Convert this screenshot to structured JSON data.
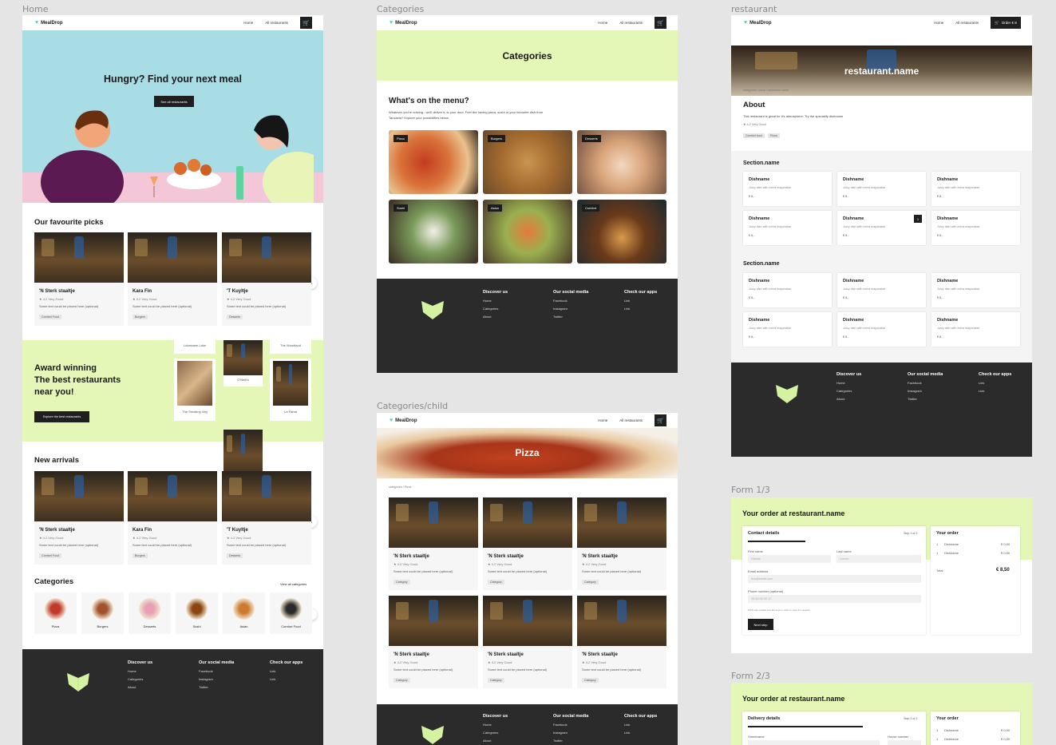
{
  "frames": {
    "home": "Home",
    "categories": "Categories",
    "restaurant": "restaurant",
    "categories_child": "Categories/child",
    "form1": "Form 1/3",
    "form2": "Form 2/3"
  },
  "nav": {
    "brand": "MealDrop",
    "home": "Home",
    "all": "All restaurants",
    "order": "Order € 8"
  },
  "home": {
    "hero_title": "Hungry? Find your next meal",
    "hero_button": "See all restaurants",
    "picks_title": "Our favourite picks",
    "picks": [
      {
        "name": "'N Sterk staaltje",
        "rating": "4.2 Very Good",
        "desc": "Some text could be placed here (optional)",
        "tag": "Comfort Food"
      },
      {
        "name": "Kara Fin",
        "rating": "4.2 Very Good",
        "desc": "Some text could be placed here (optional)",
        "tag": "Burgers"
      },
      {
        "name": "'T Kuyltje",
        "rating": "4.2 Very Good",
        "desc": "Some text could be placed here (optional)",
        "tag": "Desserts"
      }
    ],
    "award_title_1": "Award winning",
    "award_title_2": "The best restaurants near you!",
    "award_button": "Explore the best restaurants",
    "award_names": [
      "Lukewarm Lake",
      "The Woodland",
      "O'Neill's",
      "The Smoking Veg",
      "La Fama"
    ],
    "arrivals_title": "New arrivals",
    "arrivals": [
      {
        "name": "'N Sterk staaltje",
        "rating": "4.2 Very Good",
        "desc": "Some text could be placed here (optional)",
        "tag": "Comfort Food"
      },
      {
        "name": "Kara Fin",
        "rating": "4.2 Very Good",
        "desc": "Some text could be placed here (optional)",
        "tag": "Burgers"
      },
      {
        "name": "'T Kuyltje",
        "rating": "4.2 Very Good",
        "desc": "Some text could be placed here (optional)",
        "tag": "Desserts"
      }
    ],
    "categories_title": "Categories",
    "view_all": "View all categories",
    "cats": [
      "Pizza",
      "Burgers",
      "Desserts",
      "Sushi",
      "Asian",
      "Comfort Food"
    ]
  },
  "footer": {
    "col1": {
      "title": "Discover us",
      "links": [
        "Home",
        "Categories",
        "About"
      ]
    },
    "col2": {
      "title": "Our social media",
      "links": [
        "Facebook",
        "Instagram",
        "Twitter"
      ]
    },
    "col3": {
      "title": "Check our apps",
      "links": [
        "Link",
        "Link"
      ]
    }
  },
  "categories_page": {
    "hero_title": "Categories",
    "menu_title": "What's on the menu?",
    "menu_desc": "Whatever you're craving - we'll deliver it, to your door. Feel like having pizza, sushi or your favourite dish from Tanzania? Explore your possibilities below.",
    "tiles": [
      "Pizza",
      "Burgers",
      "Desserts",
      "Sushi",
      "Asian",
      "Comfort"
    ]
  },
  "child_page": {
    "hero_title": "Pizza",
    "breadcrumb": "categories / Pizza",
    "cards": [
      {
        "name": "'N Sterk staaltje",
        "rating": "4.2 Very Good",
        "desc": "Some text could be placed here (optional)",
        "tag": "Category"
      },
      {
        "name": "'N Sterk staaltje",
        "rating": "4.2 Very Good",
        "desc": "Some text could be placed here (optional)",
        "tag": "Category"
      },
      {
        "name": "'N Sterk staaltje",
        "rating": "4.2 Very Good",
        "desc": "Some text could be placed here (optional)",
        "tag": "Category"
      },
      {
        "name": "'N Sterk staaltje",
        "rating": "4.2 Very Good",
        "desc": "Some text could be placed here (optional)",
        "tag": "Category"
      },
      {
        "name": "'N Sterk staaltje",
        "rating": "4.2 Very Good",
        "desc": "Some text could be placed here (optional)",
        "tag": "Category"
      },
      {
        "name": "'N Sterk staaltje",
        "rating": "4.2 Very Good",
        "desc": "Some text could be placed here (optional)",
        "tag": "Category"
      }
    ]
  },
  "restaurant_page": {
    "hero_title": "restaurant.name",
    "breadcrumb": "categories / pizza / restaurant.name",
    "about_title": "About",
    "about_text": "This restaurant is great for it's atmosphere. Try the speciality dishname",
    "rating": "4.2 Very Good",
    "tags": [
      "Comfort food",
      "Pizza"
    ],
    "section_title": "Section.name",
    "dish_name": "Dishname",
    "dish_desc": "Juicy dish with extra mayonaise",
    "dish_price": "€ 8,-",
    "badge": "1"
  },
  "form1": {
    "title": "Your order at restaurant.name",
    "section": "Contact details",
    "step": "Step 1 of 3",
    "first_label": "First name",
    "first_ph": "Rianne",
    "last_label": "Last name",
    "last_ph": "Lianne",
    "email_label": "Email address",
    "email_ph": "rixa@email.com",
    "phone_label": "Phone number (optional)",
    "phone_ph": "06 00 00 00 12",
    "note": "We'll only contact you about your order in case it's needed.",
    "next": "Next step",
    "order_title": "Your order",
    "items": [
      {
        "qty": "1",
        "name": "Dishname",
        "price": "€ 0,50"
      },
      {
        "qty": "1",
        "name": "Dishname",
        "price": "€ 0,50"
      }
    ],
    "total_label": "Total",
    "total": "€ 8,50"
  },
  "form2": {
    "title": "Your order at restaurant.name",
    "section": "Delivery details",
    "step": "Step 2 of 3",
    "street_label": "Streetname",
    "house_label": "House number",
    "order_title": "Your order",
    "items": [
      {
        "qty": "1",
        "name": "Dishname",
        "price": "€ 0,50"
      },
      {
        "qty": "1",
        "name": "Dishname",
        "price": "€ 0,50"
      }
    ]
  }
}
